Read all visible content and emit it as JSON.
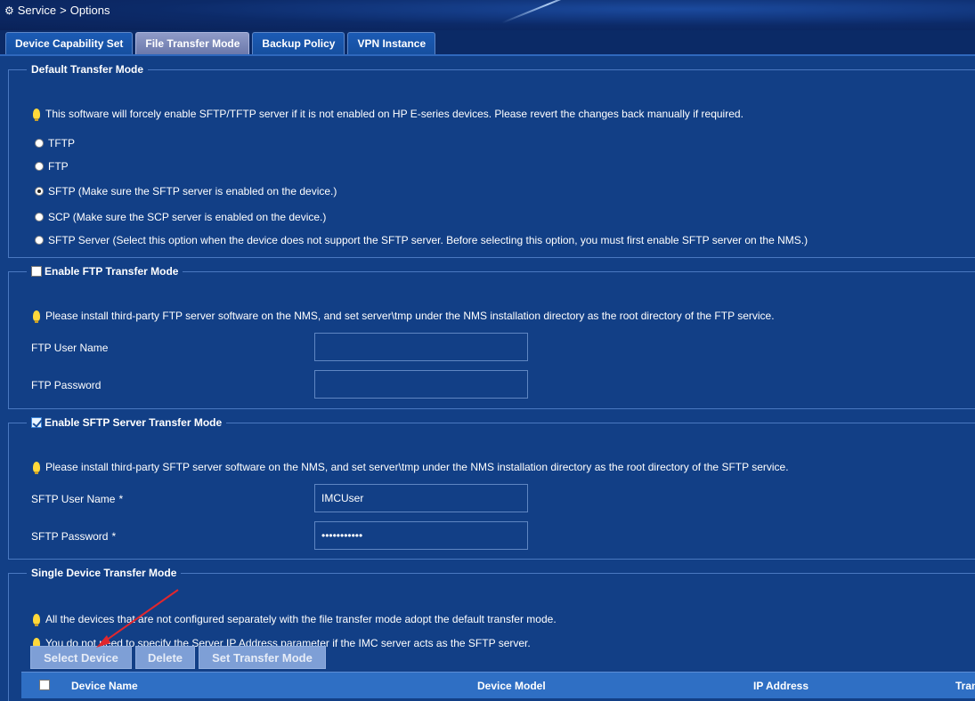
{
  "breadcrumb": {
    "service": "Service",
    "separator": ">",
    "options": "Options"
  },
  "tabs": [
    {
      "label": "Device Capability Set"
    },
    {
      "label": "File Transfer Mode"
    },
    {
      "label": "Backup Policy"
    },
    {
      "label": "VPN Instance"
    }
  ],
  "default_mode": {
    "legend": "Default Transfer Mode",
    "tip": "This software will forcely enable SFTP/TFTP server if it is not enabled on HP E-series devices. Please revert the changes back manually if required.",
    "options": [
      {
        "label": "TFTP"
      },
      {
        "label": "FTP"
      },
      {
        "label": "SFTP (Make sure the SFTP server is enabled on the device.)"
      },
      {
        "label": "SCP (Make sure the SCP server is enabled on the device.)"
      },
      {
        "label": "SFTP Server (Select this option when the device does not support the SFTP server. Before selecting this option, you must first enable SFTP server on the NMS.)"
      }
    ],
    "selected": "SFTP (Make sure the SFTP server is enabled on the device.)"
  },
  "ftp": {
    "legend": "Enable FTP Transfer Mode",
    "tip": "Please install third-party FTP server software on the NMS, and set server\\tmp under the NMS installation directory as the root directory of the FTP service.",
    "user_label": "FTP User Name",
    "user_value": "",
    "password_label": "FTP Password",
    "password_value": ""
  },
  "sftp": {
    "legend": "Enable SFTP Server Transfer Mode",
    "tip": "Please install third-party SFTP server software on the NMS, and set server\\tmp under the NMS installation directory as the root directory of the SFTP service.",
    "user_label": "SFTP User Name",
    "user_value": "IMCUser",
    "password_label": "SFTP Password",
    "password_value": "•••••••••••",
    "required_mark": "*"
  },
  "single": {
    "legend": "Single Device Transfer Mode",
    "tip1": "All the devices that are not configured separately with the file transfer mode adopt the default transfer mode.",
    "tip2": "You do not need to specify the Server IP Address parameter if the IMC server acts as the SFTP server.",
    "buttons": {
      "select": "Select Device",
      "delete": "Delete",
      "set_mode": "Set Transfer Mode"
    },
    "columns": [
      "Device Name",
      "Device Model",
      "IP Address",
      "Tran"
    ]
  },
  "colors": {
    "annotation_arrow": "#e0272e"
  }
}
